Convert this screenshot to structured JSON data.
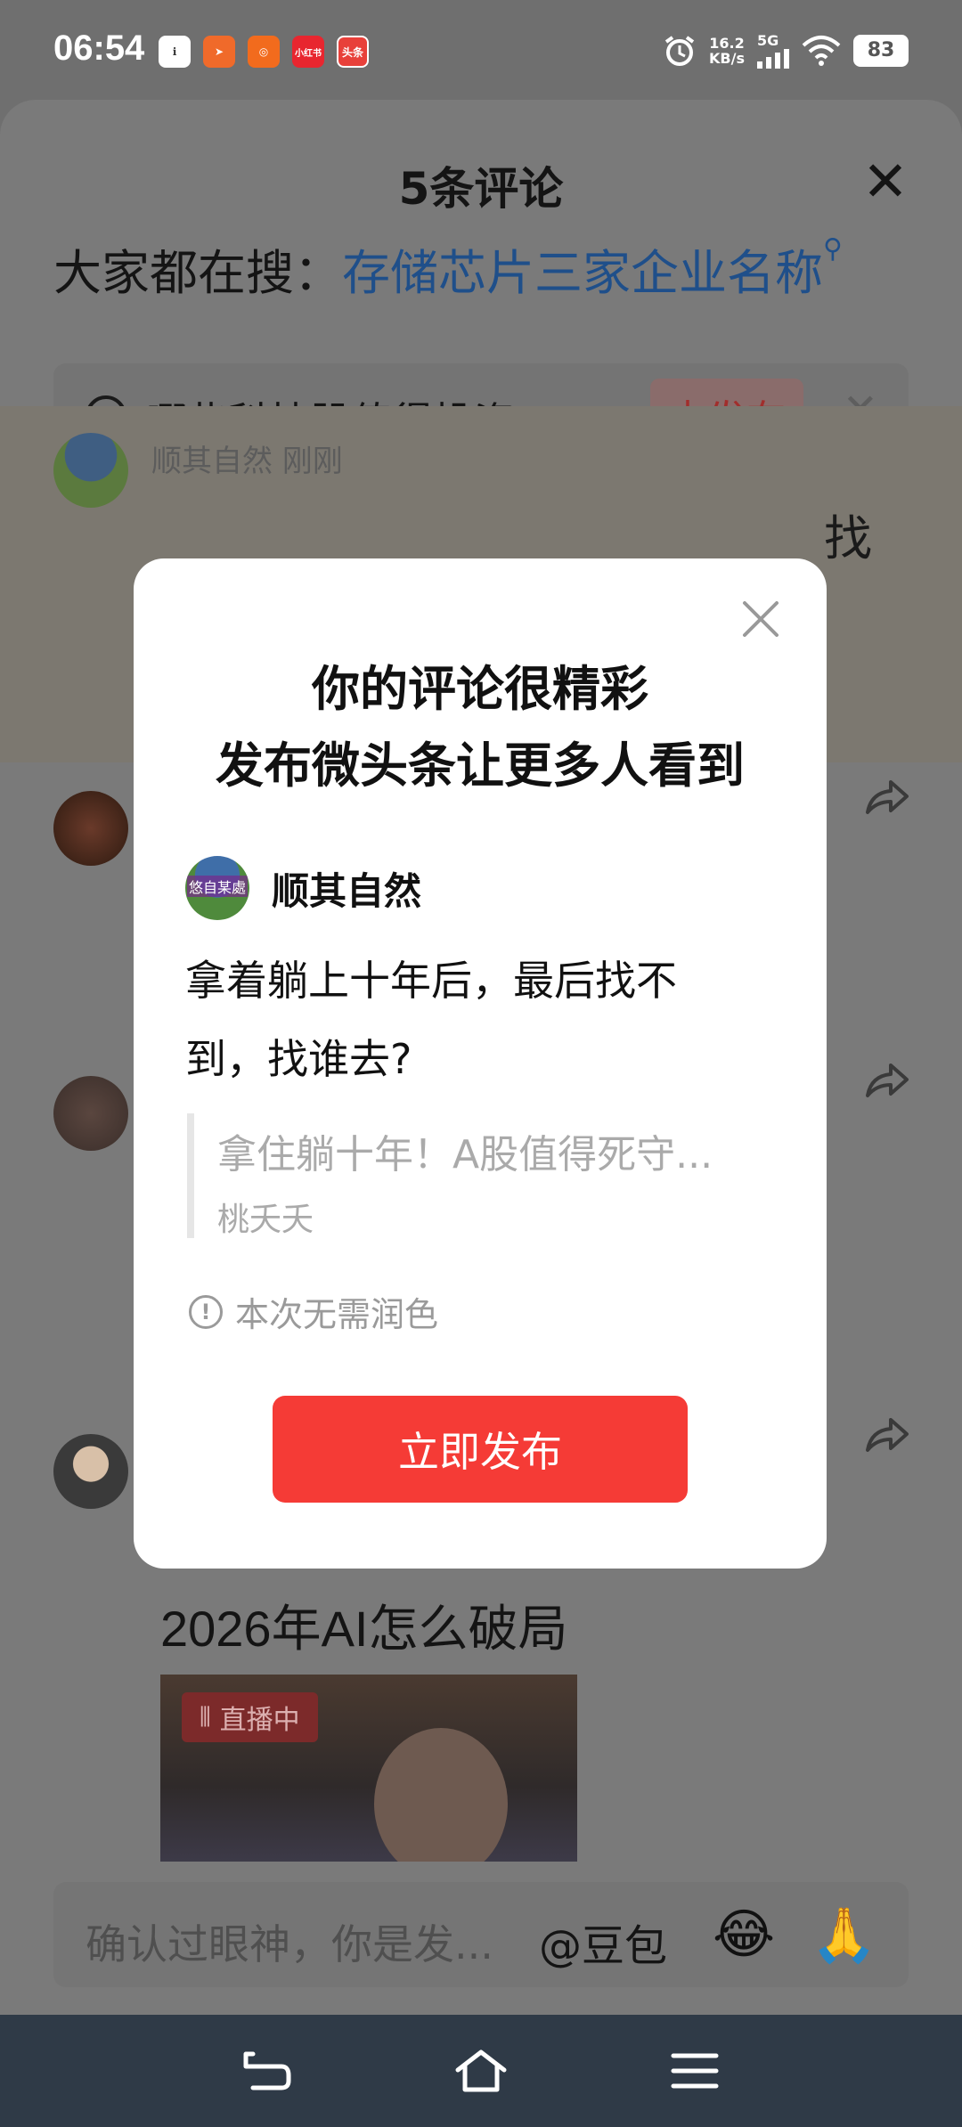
{
  "status_bar": {
    "time": "06:54",
    "net_speed_value": "16.2",
    "net_speed_unit": "KB/s",
    "network": "5G",
    "battery": "83",
    "app_icons": [
      {
        "name": "notification-app-icon",
        "color": "#ffffff",
        "text": ""
      },
      {
        "name": "send-app-icon",
        "color": "#f06a2a",
        "text": ""
      },
      {
        "name": "video-app-icon",
        "color": "#f26b1d",
        "text": ""
      },
      {
        "name": "xiaohongshu-app-icon",
        "color": "#e8262f",
        "text": "小红书"
      },
      {
        "name": "toutiao-app-icon",
        "color": "#e8403a",
        "text": "头条"
      }
    ]
  },
  "sheet": {
    "title": "5条评论",
    "trend_prefix": "大家都在搜：",
    "trend_link": "存储芯片三家企业名称",
    "topic": {
      "text": "哪些科技股值得投资",
      "button": "去发布"
    },
    "faded_name": "顺其自然  刚刚",
    "edge_char": "找",
    "edge_dot": "。",
    "post_title": "2026年AI怎么破局",
    "live_badge": "直播中",
    "input_placeholder": "确认过眼神，你是发...",
    "input_mention": "@豆包"
  },
  "dialog": {
    "title_line1": "你的评论很精彩",
    "title_line2": "发布微头条让更多人看到",
    "username": "顺其自然",
    "avatar_text": "悠自某處",
    "comment": "拿着躺上十年后，最后找不到，找谁去?",
    "quote_title": "拿住躺十年！A股值得死守...",
    "quote_author": "桃夭夭",
    "note": "本次无需润色",
    "publish_button": "立即发布"
  }
}
